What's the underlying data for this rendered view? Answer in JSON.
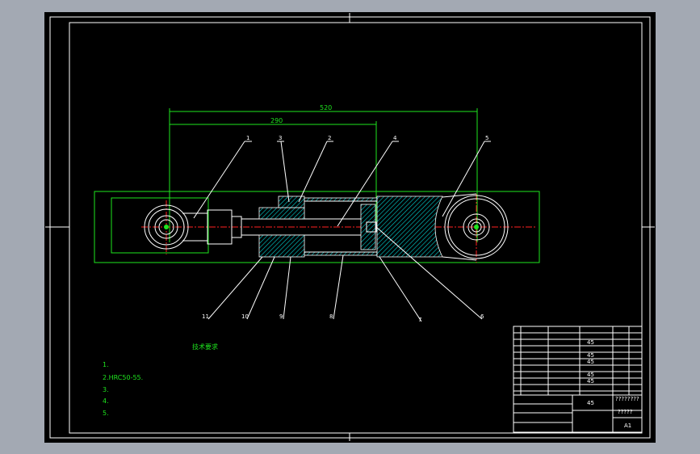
{
  "drawing": {
    "dimensions": {
      "overall_length": "520",
      "body_length": "290"
    },
    "balloons_top": [
      "1",
      "3",
      "2",
      "4",
      "5"
    ],
    "balloons_bottom": [
      "11",
      "10",
      "9",
      "8",
      "7",
      "6"
    ]
  },
  "tech_requirements": {
    "title": "技术要求",
    "lines": [
      "1.",
      "2.HRC50-55.",
      "3.",
      "4.",
      "5."
    ]
  },
  "title_block": {
    "material": "45",
    "drawing_name": "????????",
    "drawing_no": "?????",
    "sheet_size": "A1",
    "parts_materials": [
      "45",
      "45",
      "45",
      "45",
      "45"
    ]
  },
  "colors": {
    "background": "#000000",
    "lines": "#1ee61e",
    "outline": "#ffffff",
    "centerline": "#ff2020",
    "hatch": "#00c8c8",
    "frame": "#a3a9b3"
  }
}
